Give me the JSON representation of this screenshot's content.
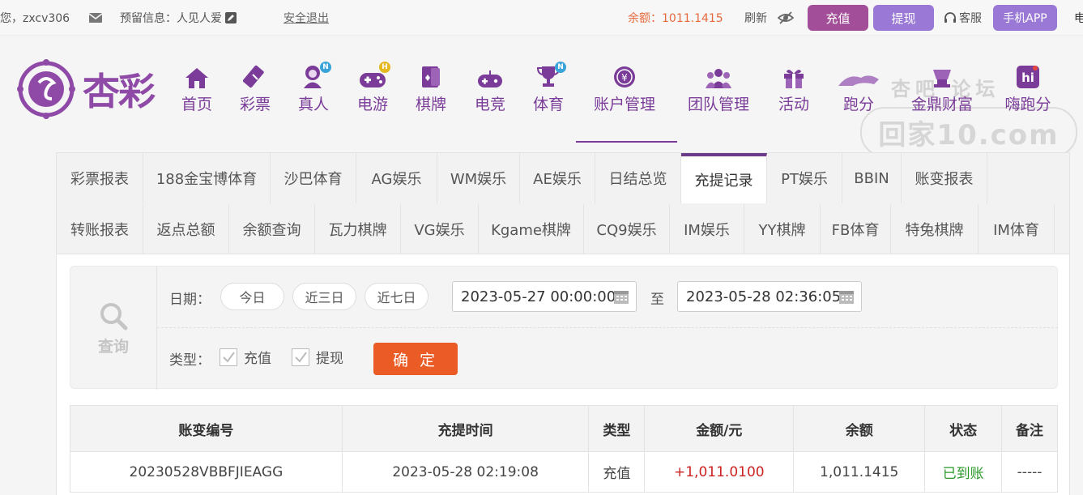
{
  "topbar": {
    "greeting": "您，zxcv306",
    "reserved": "预留信息：人见人爱",
    "logout": "安全退出",
    "balance": "余额：1011.1415",
    "refresh": "刷新",
    "recharge": "充值",
    "withdraw": "提现",
    "service": "客服",
    "mobile_app": "手机APP",
    "edge_text": "电"
  },
  "logo": {
    "brand": "杏彩"
  },
  "nav": [
    {
      "label": "首页",
      "icon": "home-icon"
    },
    {
      "label": "彩票",
      "icon": "ticket-icon"
    },
    {
      "label": "真人",
      "icon": "live-dealer-icon",
      "badge": "N"
    },
    {
      "label": "电游",
      "icon": "gamepad-icon",
      "badge": "H"
    },
    {
      "label": "棋牌",
      "icon": "cards-icon"
    },
    {
      "label": "电竞",
      "icon": "esports-icon"
    },
    {
      "label": "体育",
      "icon": "trophy-icon",
      "badge": "N"
    },
    {
      "label": "账户管理",
      "icon": "account-icon"
    },
    {
      "label": "团队管理",
      "icon": "team-icon"
    },
    {
      "label": "活动",
      "icon": "gift-icon"
    },
    {
      "label": "跑分",
      "icon": "running-icon"
    },
    {
      "label": "金鼎财富",
      "icon": "wealth-icon"
    },
    {
      "label": "嗨跑分",
      "icon": "hi-icon"
    }
  ],
  "watermark": {
    "top": "杏吧 论坛",
    "main": "回家10.com"
  },
  "tabs": {
    "row1": [
      "彩票报表",
      "188金宝博体育",
      "沙巴体育",
      "AG娱乐",
      "WM娱乐",
      "AE娱乐",
      "日结总览",
      "充提记录",
      "PT娱乐",
      "BBIN",
      "账变报表"
    ],
    "row2": [
      "转账报表",
      "返点总额",
      "余额查询",
      "瓦力棋牌",
      "VG娱乐",
      "Kgame棋牌",
      "CQ9娱乐",
      "IM娱乐",
      "YY棋牌",
      "FB体育",
      "特兔棋牌",
      "IM体育"
    ],
    "active": "充提记录"
  },
  "filter": {
    "search_label": "查询",
    "date_label": "日期：",
    "today": "今日",
    "three_days": "近三日",
    "seven_days": "近七日",
    "start": "2023-05-27 00:00:00",
    "to": "至",
    "end": "2023-05-28 02:36:05",
    "type_label": "类型：",
    "type_recharge": "充值",
    "type_withdraw": "提现",
    "confirm": "确 定"
  },
  "table": {
    "headers": [
      "账变编号",
      "充提时间",
      "类型",
      "金额/元",
      "余额",
      "状态",
      "备注"
    ],
    "rows": [
      [
        "20230528VBBFJIEAGG",
        "2023-05-28 02:19:08",
        "充值",
        "+1,011.0100",
        "1,011.1415",
        "已到账",
        "-----"
      ]
    ]
  },
  "colors": {
    "brand": "#7a3c98",
    "recharge_btn": "#a24e98",
    "withdraw_btn": "#9a78d6",
    "confirm": "#ea5b25"
  }
}
